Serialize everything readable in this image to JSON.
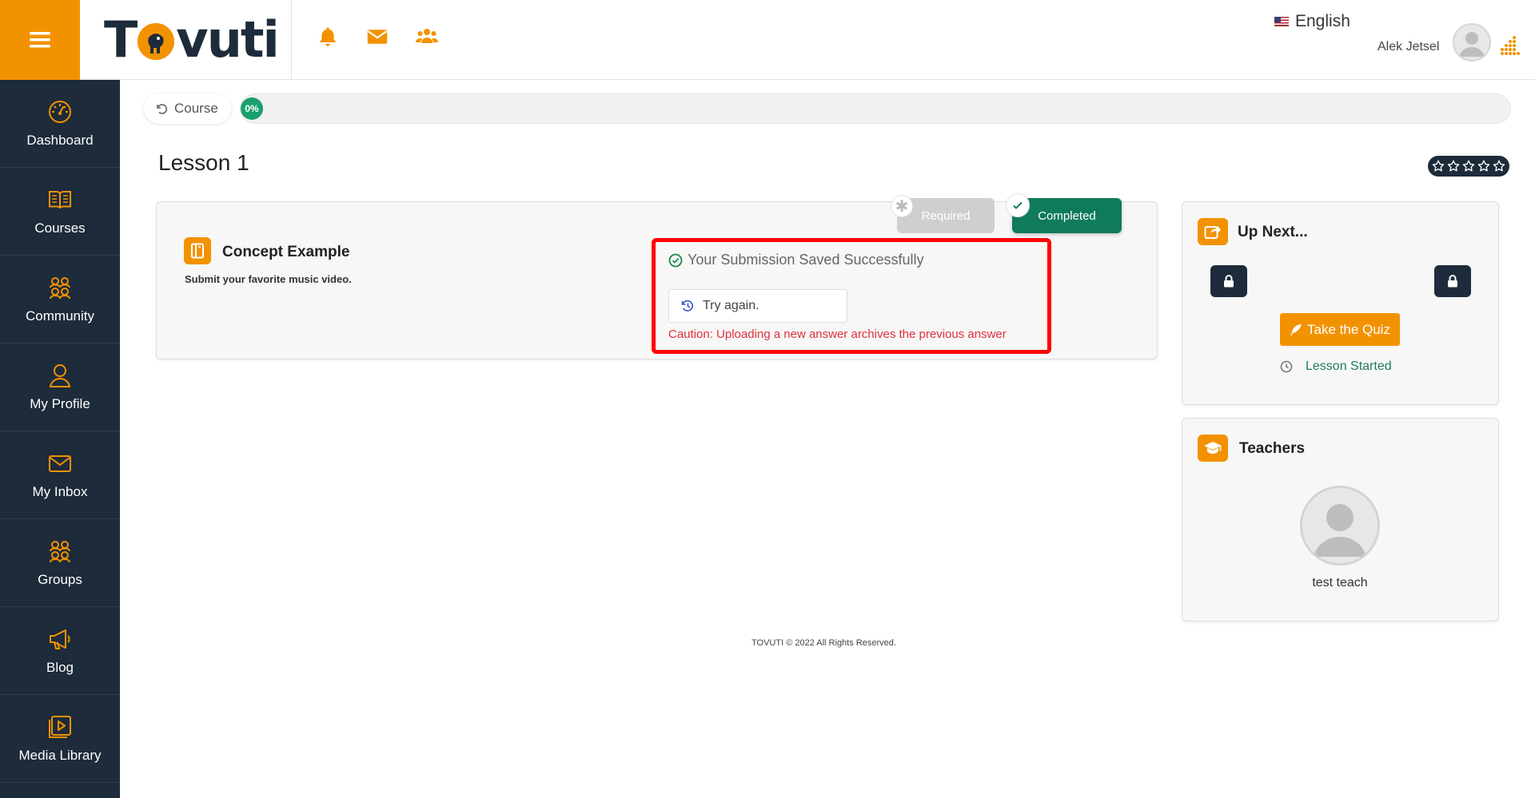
{
  "header": {
    "logo_text_left": "T",
    "logo_text_right": "vuti",
    "language": "English",
    "user_name": "Alek Jetsel"
  },
  "sidebar": {
    "items": [
      {
        "label": "Dashboard",
        "icon": "dashboard-gauge-icon"
      },
      {
        "label": "Courses",
        "icon": "book-open-icon"
      },
      {
        "label": "Community",
        "icon": "community-users-icon"
      },
      {
        "label": "My Profile",
        "icon": "user-icon"
      },
      {
        "label": "My Inbox",
        "icon": "envelope-icon"
      },
      {
        "label": "Groups",
        "icon": "groups-icon"
      },
      {
        "label": "Blog",
        "icon": "megaphone-icon"
      },
      {
        "label": "Media Library",
        "icon": "media-library-icon"
      }
    ]
  },
  "progress": {
    "course_label": "Course",
    "percent_label": "0%",
    "percent_value": 0
  },
  "lesson": {
    "title": "Lesson 1",
    "rating_stars": 5,
    "rating_filled": 0,
    "required_label": "Required",
    "completed_label": "Completed",
    "concept_title": "Concept Example",
    "concept_description": "Submit your favorite music video.",
    "submission_status": "Your Submission Saved Successfully",
    "try_again_label": "Try again.",
    "caution_text": "Caution: Uploading a new answer archives the previous answer"
  },
  "up_next": {
    "title": "Up Next...",
    "quiz_button": "Take the Quiz",
    "status_text": "Lesson Started"
  },
  "teachers": {
    "title": "Teachers",
    "list": [
      {
        "name": "test teach"
      }
    ]
  },
  "footer": {
    "copyright": "TOVUTI © 2022 All Rights Reserved."
  },
  "colors": {
    "brand_orange": "#f39200",
    "sidebar_navy": "#1d2b3a",
    "completed_green": "#0f7b5a",
    "caution_red": "#e0303a",
    "highlight_red": "#ff0000"
  }
}
